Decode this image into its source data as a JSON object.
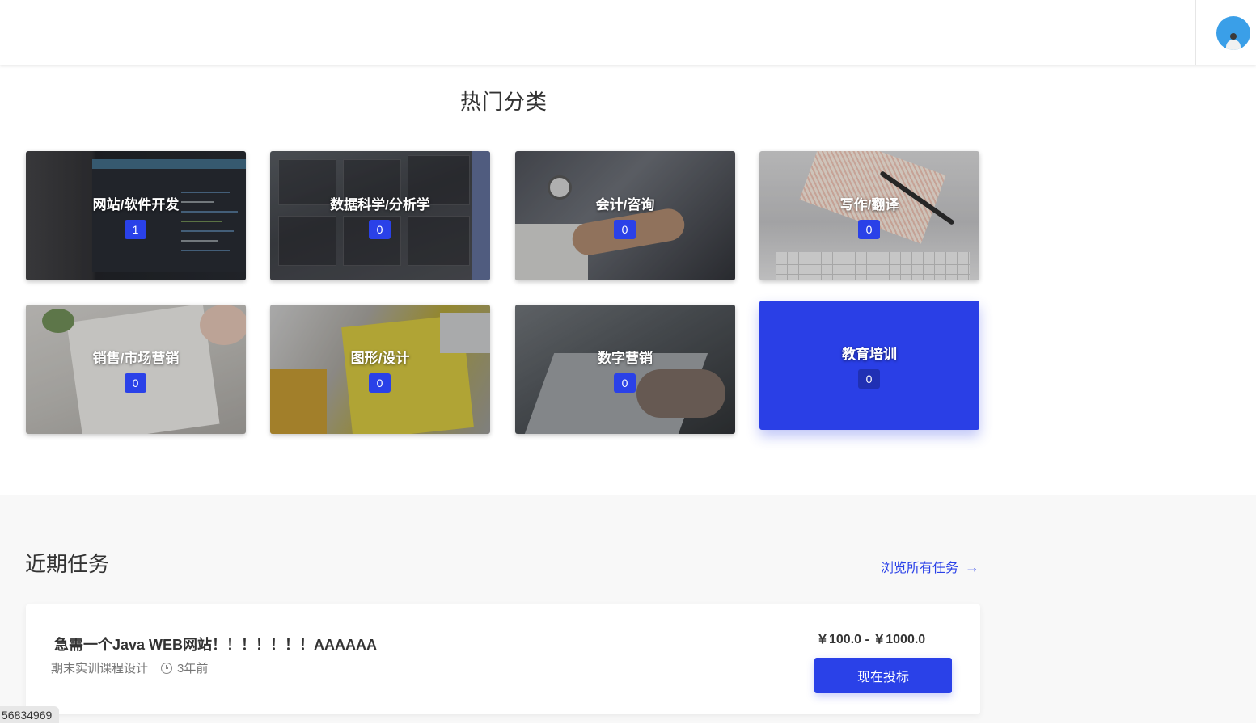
{
  "section_title": "热门分类",
  "categories": [
    {
      "name": "网站/软件开发",
      "count": "1"
    },
    {
      "name": "数据科学/分析学",
      "count": "0"
    },
    {
      "name": "会计/咨询",
      "count": "0"
    },
    {
      "name": "写作/翻译",
      "count": "0"
    },
    {
      "name": "销售/市场营销",
      "count": "0"
    },
    {
      "name": "图形/设计",
      "count": "0"
    },
    {
      "name": "数字营销",
      "count": "0"
    },
    {
      "name": "教育培训",
      "count": "0"
    }
  ],
  "recent": {
    "title": "近期任务",
    "browse_label": "浏览所有任务",
    "browse_arrow": "→"
  },
  "tasks": [
    {
      "title": "急需一个Java WEB网站！！！！！！！AAAAAA",
      "category": "期末实训课程设计",
      "time": "3年前",
      "price": "￥100.0 - ￥1000.0",
      "button": "现在投标"
    }
  ],
  "corner_id": "56834969",
  "colors": {
    "accent": "#2a41e8",
    "active_card": "#2a3fe6",
    "gray_bg": "#f8f8f8"
  },
  "icons": [
    "user-avatar-icon",
    "clock-icon",
    "arrow-right-icon"
  ]
}
